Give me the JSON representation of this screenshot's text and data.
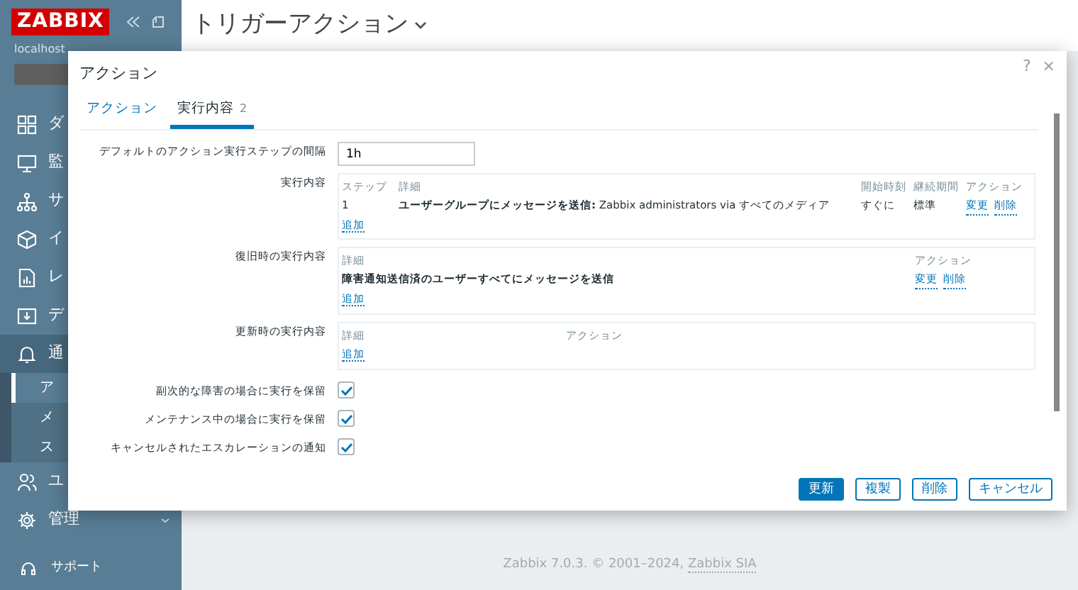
{
  "sidebar": {
    "logo": "ZABBIX",
    "server": "localhost",
    "items": [
      {
        "label": "ダ",
        "selected": false
      },
      {
        "label": "監",
        "selected": false
      },
      {
        "label": "サ",
        "selected": false
      },
      {
        "label": "イ",
        "selected": false
      },
      {
        "label": "レ",
        "selected": false
      },
      {
        "label": "デ",
        "selected": false
      },
      {
        "label": "通",
        "selected": false,
        "children": [
          {
            "label": "ア",
            "selected": true
          },
          {
            "label": "メ",
            "selected": false
          },
          {
            "label": "ス",
            "selected": false
          }
        ]
      },
      {
        "label": "ユ",
        "selected": false
      },
      {
        "label": "管理",
        "selected": false
      }
    ],
    "support": "サポート"
  },
  "page": {
    "title": "トリガーアクション"
  },
  "dialog": {
    "title": "アクション",
    "help": "?",
    "close": "×",
    "tabs": [
      {
        "label": "アクション",
        "selected": false
      },
      {
        "label": "実行内容",
        "count": "2",
        "selected": true
      }
    ],
    "step_label": "デフォルトのアクション実行ステップの間隔",
    "step_value": "1h",
    "operations": {
      "label": "実行内容",
      "columns": [
        "ステップ",
        "詳細",
        "開始時刻",
        "継続期間",
        "アクション"
      ],
      "rows": [
        {
          "step": "1",
          "details": "**ユーザーグループにメッセージを送信:** Zabbix administrators via すべてのメディア",
          "start": "すぐに",
          "duration": "標準",
          "links": [
            "変更",
            "削除"
          ]
        }
      ],
      "add": "追加"
    },
    "recovery": {
      "label": "復旧時の実行内容",
      "columns": [
        "詳細",
        "アクション"
      ],
      "rows": [
        {
          "details": "障害通知送信済のユーザーすべてにメッセージを送信",
          "links": [
            "変更",
            "削除"
          ]
        }
      ],
      "add": "追加"
    },
    "update": {
      "label": "更新時の実行内容",
      "columns": [
        "詳細",
        "アクション"
      ],
      "add": "追加"
    },
    "checks": [
      {
        "label": "副次的な障害の場合に実行を保留",
        "checked": true
      },
      {
        "label": "メンテナンス中の場合に実行を保留",
        "checked": true
      },
      {
        "label": "キャンセルされたエスカレーションの通知",
        "checked": true
      }
    ],
    "buttons": [
      {
        "label": "更新",
        "kind": "primary"
      },
      {
        "label": "複製",
        "kind": "outline"
      },
      {
        "label": "削除",
        "kind": "outline"
      },
      {
        "label": "キャンセル",
        "kind": "outline"
      }
    ]
  },
  "footer": {
    "text": "Zabbix 7.0.3. © 2001–2024,",
    "link": "Zabbix SIA"
  }
}
